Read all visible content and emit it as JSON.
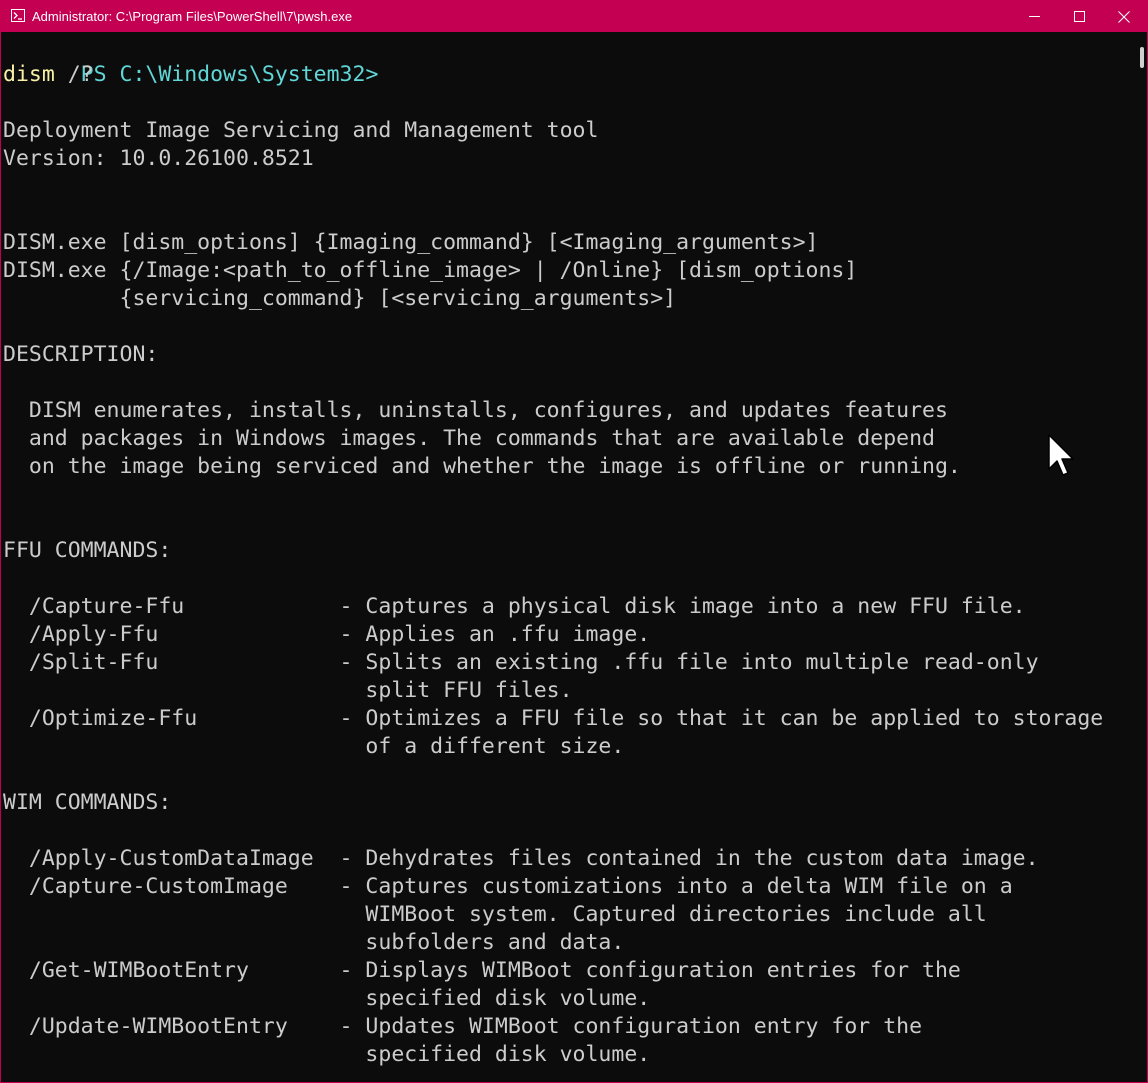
{
  "window": {
    "title": "Administrator: C:\\Program Files\\PowerShell\\7\\pwsh.exe"
  },
  "terminal": {
    "prompt": "PS C:\\Windows\\System32>",
    "command": "dism",
    "command_args": " /?",
    "lines": [
      "",
      "Deployment Image Servicing and Management tool",
      "Version: 10.0.26100.8521",
      "",
      "",
      "DISM.exe [dism_options] {Imaging_command} [<Imaging_arguments>]",
      "DISM.exe {/Image:<path_to_offline_image> | /Online} [dism_options]",
      "         {servicing_command} [<servicing_arguments>]",
      "",
      "DESCRIPTION:",
      "",
      "  DISM enumerates, installs, uninstalls, configures, and updates features",
      "  and packages in Windows images. The commands that are available depend",
      "  on the image being serviced and whether the image is offline or running.",
      "",
      "",
      "FFU COMMANDS:",
      "",
      "  /Capture-Ffu            - Captures a physical disk image into a new FFU file.",
      "  /Apply-Ffu              - Applies an .ffu image.",
      "  /Split-Ffu              - Splits an existing .ffu file into multiple read-only",
      "                            split FFU files.",
      "  /Optimize-Ffu           - Optimizes a FFU file so that it can be applied to storage",
      "                            of a different size.",
      "",
      "WIM COMMANDS:",
      "",
      "  /Apply-CustomDataImage  - Dehydrates files contained in the custom data image.",
      "  /Capture-CustomImage    - Captures customizations into a delta WIM file on a",
      "                            WIMBoot system. Captured directories include all",
      "                            subfolders and data.",
      "  /Get-WIMBootEntry       - Displays WIMBoot configuration entries for the",
      "                            specified disk volume.",
      "  /Update-WIMBootEntry    - Updates WIMBoot configuration entry for the",
      "                            specified disk volume."
    ]
  },
  "colors": {
    "titlebar": "#c30052",
    "background": "#0c0c0c",
    "text": "#cccccc",
    "prompt": "#61d6d6",
    "command": "#f9f1a5"
  },
  "icons": {
    "app": "powershell-icon",
    "minimize": "minimize-icon",
    "maximize": "maximize-icon",
    "close": "close-icon"
  }
}
